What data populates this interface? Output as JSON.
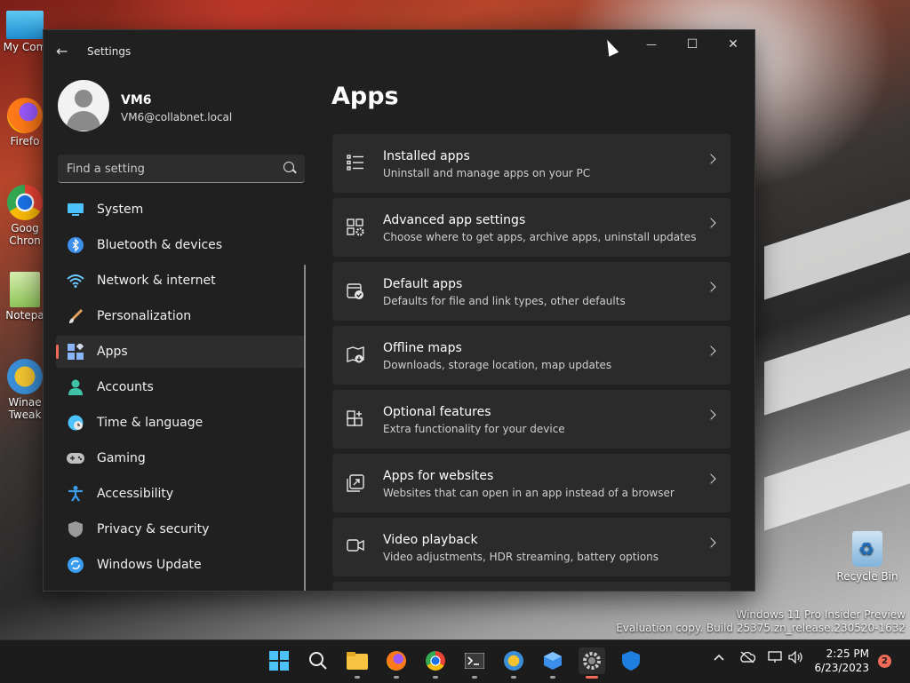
{
  "desktop": {
    "icons": [
      {
        "label": "My Com"
      },
      {
        "label": "Firefo"
      },
      {
        "label": "Goog\nChron"
      },
      {
        "label": "Notepa"
      },
      {
        "label": "Winae\nTweak"
      }
    ],
    "recycle_bin": "Recycle Bin",
    "watermark_line1": "Windows 11 Pro Insider Preview",
    "watermark_line2": "Evaluation copy. Build 25375.zn_release.230520-1632"
  },
  "window": {
    "title": "Settings",
    "minimize_glyph": "—",
    "maximize_glyph": "☐",
    "close_glyph": "✕",
    "back_glyph": "←"
  },
  "user": {
    "name": "VM6",
    "email": "VM6@collabnet.local"
  },
  "search": {
    "placeholder": "Find a setting"
  },
  "nav": [
    {
      "label": "System",
      "icon": "monitor-icon",
      "color": "#4cc2ff"
    },
    {
      "label": "Bluetooth & devices",
      "icon": "bluetooth-icon",
      "color": "#3b8eea"
    },
    {
      "label": "Network & internet",
      "icon": "wifi-icon",
      "color": "#6ccbff"
    },
    {
      "label": "Personalization",
      "icon": "brush-icon",
      "color": "#e8a35c"
    },
    {
      "label": "Apps",
      "icon": "apps-icon",
      "color": "#8ab4f8"
    },
    {
      "label": "Accounts",
      "icon": "person-icon",
      "color": "#3fc3a7"
    },
    {
      "label": "Time & language",
      "icon": "globe-clock-icon",
      "color": "#4cc2ff"
    },
    {
      "label": "Gaming",
      "icon": "gamepad-icon",
      "color": "#bfbfbf"
    },
    {
      "label": "Accessibility",
      "icon": "accessibility-icon",
      "color": "#3b9cf0"
    },
    {
      "label": "Privacy & security",
      "icon": "shield-icon",
      "color": "#9a9a9a"
    },
    {
      "label": "Windows Update",
      "icon": "update-icon",
      "color": "#3b9cf0"
    }
  ],
  "active_nav": "Apps",
  "main": {
    "title": "Apps",
    "cards": [
      {
        "title": "Installed apps",
        "subtitle": "Uninstall and manage apps on your PC",
        "icon": "list-icon"
      },
      {
        "title": "Advanced app settings",
        "subtitle": "Choose where to get apps, archive apps, uninstall updates",
        "icon": "app-settings-icon"
      },
      {
        "title": "Default apps",
        "subtitle": "Defaults for file and link types, other defaults",
        "icon": "default-apps-icon"
      },
      {
        "title": "Offline maps",
        "subtitle": "Downloads, storage location, map updates",
        "icon": "map-icon"
      },
      {
        "title": "Optional features",
        "subtitle": "Extra functionality for your device",
        "icon": "add-feature-icon"
      },
      {
        "title": "Apps for websites",
        "subtitle": "Websites that can open in an app instead of a browser",
        "icon": "open-in-app-icon"
      },
      {
        "title": "Video playback",
        "subtitle": "Video adjustments, HDR streaming, battery options",
        "icon": "video-icon"
      }
    ]
  },
  "taskbar": {
    "time": "2:25 PM",
    "date": "6/23/2023",
    "notifications": "2",
    "accent": "#f06c58"
  }
}
